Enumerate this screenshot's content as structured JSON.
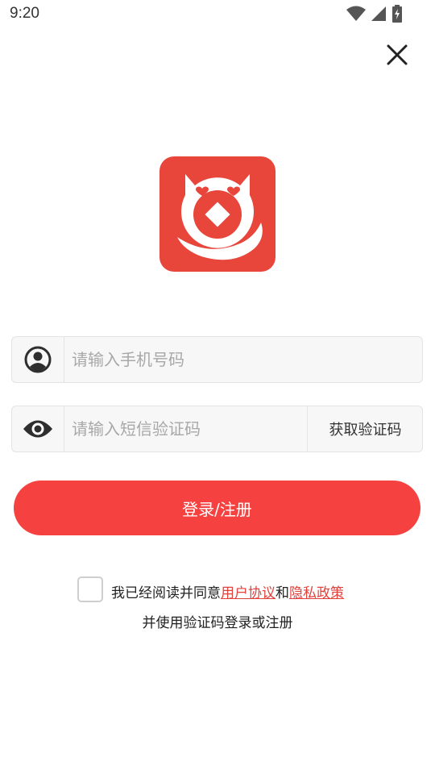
{
  "status_bar": {
    "time": "9:20"
  },
  "icons": {
    "close": "close-icon",
    "user": "user-circle-icon",
    "eye": "eye-icon",
    "logo": "cat-coin-logo"
  },
  "colors": {
    "accent": "#f5413f",
    "logo_bg": "#e8463a",
    "link": "#e2413c"
  },
  "phone_input": {
    "placeholder": "请输入手机号码",
    "value": ""
  },
  "code_input": {
    "placeholder": "请输入短信验证码",
    "value": ""
  },
  "get_code_label": "获取验证码",
  "login_button": "登录/注册",
  "agreement": {
    "checked": false,
    "prefix": "我已经阅读并同意",
    "user_agreement": "用户协议",
    "and": "和",
    "privacy_policy": "隐私政策",
    "line2": "并使用验证码登录或注册"
  }
}
